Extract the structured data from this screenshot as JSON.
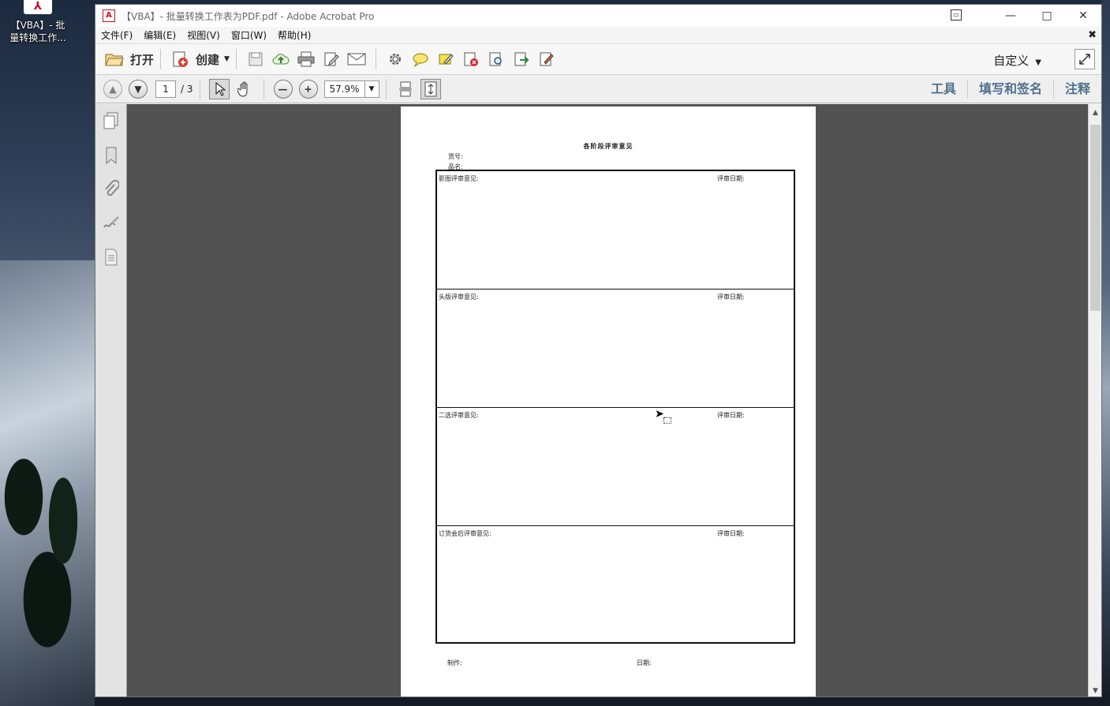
{
  "desktop": {
    "icon_label": "【VBA】- 批量转换工作..."
  },
  "window": {
    "title": "【VBA】- 批量转换工作表为PDF.pdf - Adobe Acrobat Pro"
  },
  "menu": [
    "文件(F)",
    "编辑(E)",
    "视图(V)",
    "窗口(W)",
    "帮助(H)"
  ],
  "toolbar": {
    "open_label": "打开",
    "create_label": "创建",
    "customize_label": "自定义"
  },
  "nav": {
    "page_current": "1",
    "page_total": "/ 3",
    "zoom": "57.9%"
  },
  "right_tabs": [
    "工具",
    "填写和签名",
    "注释"
  ],
  "document": {
    "title": "各阶段评审意见",
    "field_item_no": "货号:",
    "field_item_name": "品名:",
    "rows": [
      {
        "label": "影图评审意见:",
        "date": "评审日期:"
      },
      {
        "label": "头版评审意见:",
        "date": "评审日期:"
      },
      {
        "label": "二选评审意见:",
        "date": "评审日期:"
      },
      {
        "label": "订货会后评审意见:",
        "date": "评审日期:"
      }
    ],
    "footer_maker": "制作:",
    "footer_date": "日期:"
  },
  "colors": {
    "accent_tab": "#4f6f8c",
    "doc_background": "#525252",
    "pdf_red": "#c8102e"
  }
}
